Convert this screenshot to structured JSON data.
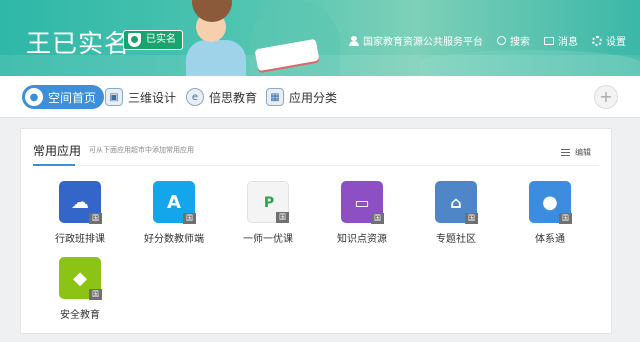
{
  "header": {
    "user_name": "王已实名",
    "verified_label": "已实名",
    "nav": [
      {
        "label": "国家教育资源公共服务平台",
        "icon": "person-icon"
      },
      {
        "label": "搜索",
        "icon": "search-icon"
      },
      {
        "label": "消息",
        "icon": "mail-icon"
      },
      {
        "label": "设置",
        "icon": "gear-icon"
      }
    ]
  },
  "tabs": [
    {
      "label": "空间首页",
      "active": true,
      "icon": "home-icon"
    },
    {
      "label": "三维设计",
      "active": false,
      "icon": "design-icon"
    },
    {
      "label": "倍思教育",
      "active": false,
      "icon": "edu-icon"
    },
    {
      "label": "应用分类",
      "active": false,
      "icon": "category-icon"
    }
  ],
  "add_label": "+",
  "panel": {
    "title": "常用应用",
    "hint": "可从下面应用超市中添加常用应用",
    "edit_label": "编辑",
    "badge": "国",
    "apps": [
      {
        "label": "行政班排课",
        "icon": "schedule-app-icon",
        "color": "#3466c9"
      },
      {
        "label": "好分数教师端",
        "icon": "score-app-icon",
        "color": "#14a6ea"
      },
      {
        "label": "一师一优课",
        "icon": "lesson-app-icon",
        "color": "#f4f4f4"
      },
      {
        "label": "知识点资源",
        "icon": "knowledge-app-icon",
        "color": "#8c4fc4"
      },
      {
        "label": "专题社区",
        "icon": "community-app-icon",
        "color": "#4f86c8"
      },
      {
        "label": "体系通",
        "icon": "system-app-icon",
        "color": "#3c8de0"
      },
      {
        "label": "安全教育",
        "icon": "safety-app-icon",
        "color": "#8bc415"
      }
    ]
  }
}
